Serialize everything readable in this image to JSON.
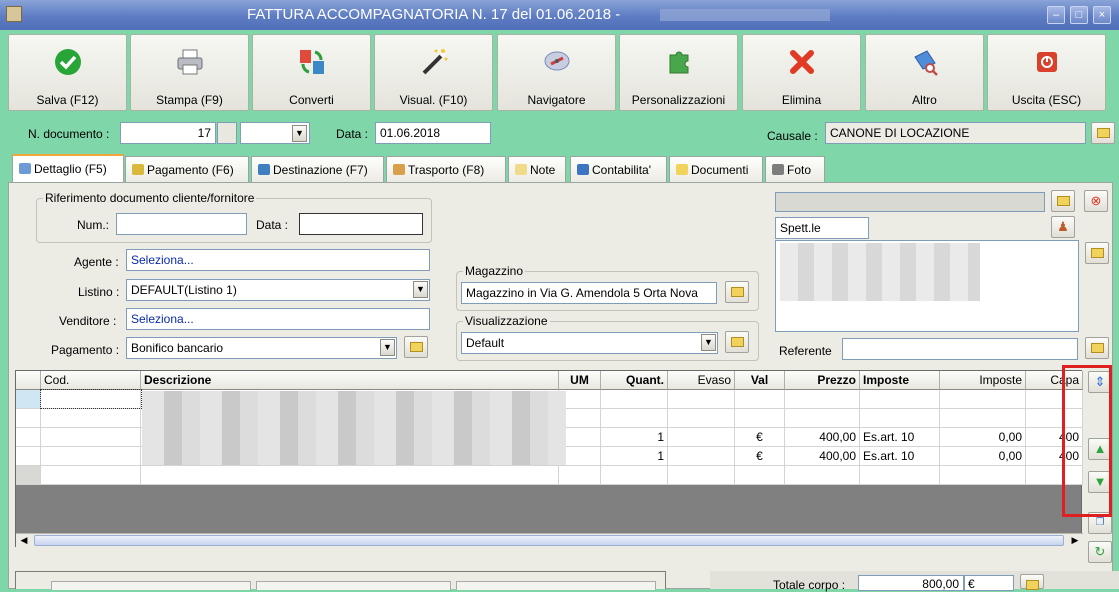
{
  "window": {
    "title": "FATTURA ACCOMPAGNATORIA N. 17 del 01.06.2018 -"
  },
  "toolbar": [
    {
      "id": "save",
      "label": "Salva (F12)",
      "icon": "check-icon",
      "color": "#27a637"
    },
    {
      "id": "print",
      "label": "Stampa (F9)",
      "icon": "printer-icon",
      "color": "#8a8f99"
    },
    {
      "id": "convert",
      "label": "Converti",
      "icon": "convert-icon",
      "color": "#3b88c7"
    },
    {
      "id": "view",
      "label": "Visual. (F10)",
      "icon": "magic-wand-icon",
      "color": "#444444"
    },
    {
      "id": "navigator",
      "label": "Navigatore",
      "icon": "compass-icon",
      "color": "#7a8ab8"
    },
    {
      "id": "customize",
      "label": "Personalizzazioni",
      "icon": "puzzle-icon",
      "color": "#4aa64a"
    },
    {
      "id": "delete",
      "label": "Elimina",
      "icon": "x-icon",
      "color": "#e03a24"
    },
    {
      "id": "other",
      "label": "Altro",
      "icon": "search-doc-icon",
      "color": "#3a74c8"
    },
    {
      "id": "exit",
      "label": "Uscita (ESC)",
      "icon": "power-icon",
      "color": "#d9412d"
    }
  ],
  "header": {
    "doc_number_label": "N. documento :",
    "doc_number": "17",
    "date_label": "Data :",
    "date": "01.06.2018",
    "causale_label": "Causale :",
    "causale": "CANONE DI LOCAZIONE"
  },
  "tabs": [
    {
      "label": "Dettaglio (F5)",
      "active": true
    },
    {
      "label": "Pagamento (F6)"
    },
    {
      "label": "Destinazione (F7)"
    },
    {
      "label": "Trasporto (F8)"
    },
    {
      "label": "Note"
    },
    {
      "label": "Contabilita'"
    },
    {
      "label": "Documenti"
    },
    {
      "label": "Foto"
    }
  ],
  "detail": {
    "ref_group_label": "Riferimento documento cliente/fornitore",
    "num_label": "Num.:",
    "num_value": "",
    "ref_date_label": "Data :",
    "ref_date_value": "",
    "agent_label": "Agente :",
    "agent_value": "Seleziona...",
    "listino_label": "Listino :",
    "listino_value": "DEFAULT(Listino 1)",
    "seller_label": "Venditore :",
    "seller_value": "Seleziona...",
    "payment_label": "Pagamento :",
    "payment_value": "Bonifico bancario",
    "warehouse_group_label": "Magazzino",
    "warehouse_value": "Magazzino in Via G. Amendola 5 Orta Nova",
    "view_group_label": "Visualizzazione",
    "view_value": "Default",
    "customer_salutation": "Spett.le",
    "referente_label": "Referente",
    "referente_value": ""
  },
  "grid": {
    "columns": [
      "Cod.",
      "Descrizione",
      "UM",
      "Quant.",
      "Evaso",
      "Val",
      "Prezzo",
      "Imposte",
      "Imposte",
      "Capa"
    ],
    "rows": [
      {
        "cod": "",
        "um": "",
        "qty": "",
        "evaso": "",
        "val": "",
        "price": "",
        "tax": "",
        "tax_amt": "",
        "cap": ""
      },
      {
        "cod": "",
        "um": "",
        "qty": "",
        "evaso": "",
        "val": "",
        "price": "",
        "tax": "",
        "tax_amt": "",
        "cap": ""
      },
      {
        "cod": "",
        "um": "",
        "qty": "1",
        "evaso": "",
        "val": "€",
        "price": "400,00",
        "tax": "Es.art. 10",
        "tax_amt": "0,00",
        "cap": "400"
      },
      {
        "cod": "",
        "um": "",
        "qty": "1",
        "evaso": "",
        "val": "€",
        "price": "400,00",
        "tax": "Es.art. 10",
        "tax_amt": "0,00",
        "cap": "400"
      },
      {
        "cod": "",
        "um": "",
        "qty": "",
        "evaso": "",
        "val": "",
        "price": "",
        "tax": "",
        "tax_amt": "",
        "cap": ""
      }
    ]
  },
  "totals": {
    "label": "Totale corpo :",
    "value": "800,00",
    "currency": "€"
  },
  "colors": {
    "background": "#7fd6a8",
    "titlebar": "#5d7cc2",
    "highlight": "#e02020",
    "panel": "#ecebe4"
  }
}
